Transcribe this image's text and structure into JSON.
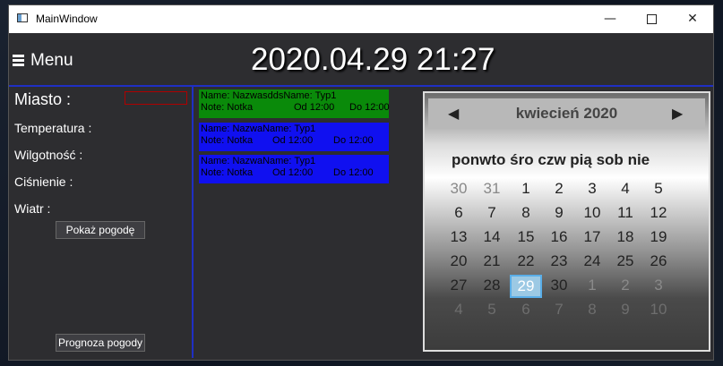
{
  "window": {
    "title": "MainWindow",
    "controls": {
      "minimize": "—",
      "maximize": "",
      "close": "✕"
    }
  },
  "header": {
    "menu_label": "Menu",
    "datetime": "2020.04.29 21:27"
  },
  "weather": {
    "city_label": "Miasto :",
    "city_value": "",
    "temperature_label": "Temperatura :",
    "humidity_label": "Wilgotność :",
    "pressure_label": "Ciśnienie :",
    "wind_label": "Wiatr :",
    "show_button": "Pokaż pogodę",
    "forecast_button": "Prognoza pogody"
  },
  "notes": [
    {
      "name": "Name: NazwasddsName: Typ1",
      "note": "Note: Notka",
      "from": "Od 12:00",
      "to": "Do 12:00",
      "color": "#0a8a0a"
    },
    {
      "name": "Name: NazwaName: Typ1",
      "note": "Note: Notka",
      "from": "Od 12:00",
      "to": "Do 12:00",
      "color": "#1010f0"
    },
    {
      "name": "Name: NazwaName: Typ1",
      "note": "Note: Notka",
      "from": "Od 12:00",
      "to": "Do 12:00",
      "color": "#1010f0"
    }
  ],
  "calendar": {
    "month_title": "kwiecień 2020",
    "prev_icon": "◀",
    "next_icon": "▶",
    "weekdays": [
      "pon",
      "wto",
      "śro",
      "czw",
      "pią",
      "sob",
      "nie"
    ],
    "selected_day": "29",
    "weeks": [
      [
        "30",
        "31",
        "1",
        "2",
        "3",
        "4",
        "5"
      ],
      [
        "6",
        "7",
        "8",
        "9",
        "10",
        "11",
        "12"
      ],
      [
        "13",
        "14",
        "15",
        "16",
        "17",
        "18",
        "19"
      ],
      [
        "20",
        "21",
        "22",
        "23",
        "24",
        "25",
        "26"
      ],
      [
        "27",
        "28",
        "29",
        "30",
        "1",
        "2",
        "3"
      ],
      [
        "4",
        "5",
        "6",
        "7",
        "8",
        "9",
        "10"
      ]
    ]
  }
}
